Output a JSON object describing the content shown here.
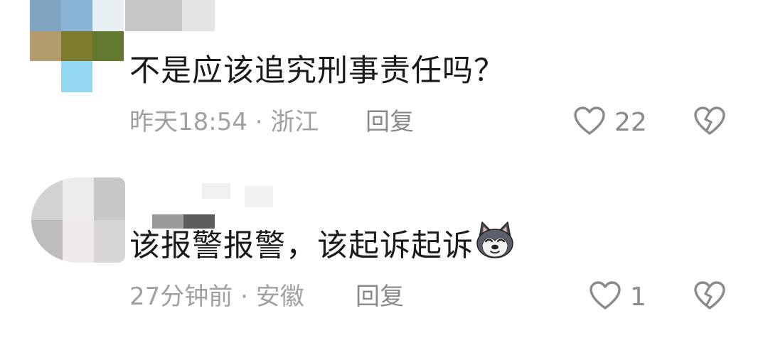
{
  "comments": [
    {
      "text": "不是应该追究刑事责任吗？",
      "time": "昨天18:54",
      "separator": " · ",
      "location": "浙江",
      "reply_label": "回复",
      "likes": "22",
      "icons": [
        "heart-outline-icon",
        "broken-heart-icon"
      ]
    },
    {
      "text": "该报警报警，该起诉起诉",
      "emoji": "husky-dog-emoji",
      "time": "27分钟前",
      "separator": " · ",
      "location": "安徽",
      "reply_label": "回复",
      "likes": "1",
      "icons": [
        "heart-outline-icon",
        "broken-heart-icon"
      ]
    }
  ],
  "colors": {
    "text": "#1a1a1a",
    "meta": "#a0a0a0",
    "action": "#8a8a8a",
    "background": "#ffffff"
  }
}
